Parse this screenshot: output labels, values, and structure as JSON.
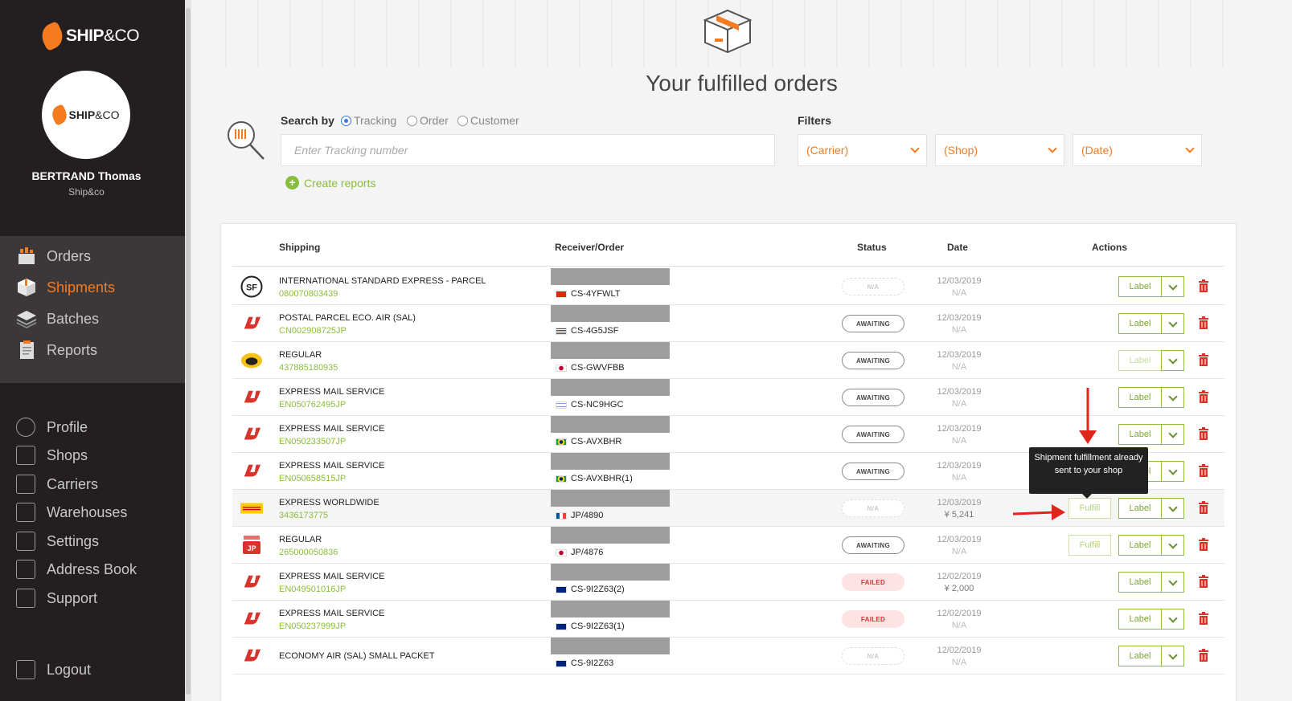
{
  "sidebar": {
    "brand": "SHIP&CO",
    "user_name": "BERTRAND Thomas",
    "user_company": "Ship&co",
    "main_nav": [
      {
        "label": "Orders",
        "icon": "orders-icon",
        "active": false
      },
      {
        "label": "Shipments",
        "icon": "shipments-icon",
        "active": true
      },
      {
        "label": "Batches",
        "icon": "batches-icon",
        "active": false
      },
      {
        "label": "Reports",
        "icon": "reports-icon",
        "active": false
      }
    ],
    "secondary_nav": [
      {
        "label": "Profile",
        "icon": "profile-icon"
      },
      {
        "label": "Shops",
        "icon": "shops-icon"
      },
      {
        "label": "Carriers",
        "icon": "carriers-icon"
      },
      {
        "label": "Warehouses",
        "icon": "warehouses-icon"
      },
      {
        "label": "Settings",
        "icon": "settings-icon"
      },
      {
        "label": "Address Book",
        "icon": "address-book-icon"
      },
      {
        "label": "Support",
        "icon": "support-icon"
      }
    ],
    "logout_label": "Logout"
  },
  "page": {
    "title": "Your fulfilled orders"
  },
  "search": {
    "label": "Search by",
    "options": [
      "Tracking",
      "Order",
      "Customer"
    ],
    "selected": "Tracking",
    "placeholder": "Enter Tracking number",
    "create_reports": "Create reports"
  },
  "filters": {
    "label": "Filters",
    "carrier": "(Carrier)",
    "shop": "(Shop)",
    "date": "(Date)"
  },
  "table": {
    "headers": {
      "shipping": "Shipping",
      "receiver": "Receiver/Order",
      "status": "Status",
      "date": "Date",
      "actions": "Actions"
    },
    "label_button": "Label",
    "fulfill_button": "Fulfill",
    "rows": [
      {
        "carrier": "SF",
        "service": "INTERNATIONAL STANDARD EXPRESS - PARCEL",
        "tracking": "080070803439",
        "flag": "CN",
        "order": "CS-4YFWLT",
        "status": "N/A",
        "status_type": "na",
        "date": "12/03/2019",
        "amount": "N/A",
        "fulfill": false,
        "label_dim": false
      },
      {
        "carrier": "JP",
        "service": "POSTAL PARCEL ECO. AIR (SAL)",
        "tracking": "CN002908725JP",
        "flag": "US",
        "order": "CS-4G5JSF",
        "status": "AWAITING",
        "status_type": "awaiting",
        "date": "12/03/2019",
        "amount": "N/A",
        "fulfill": false,
        "label_dim": false
      },
      {
        "carrier": "YAMATO",
        "service": "REGULAR",
        "tracking": "437885180935",
        "flag": "JP",
        "order": "CS-GWVFBB",
        "status": "AWAITING",
        "status_type": "awaiting",
        "date": "12/03/2019",
        "amount": "N/A",
        "fulfill": false,
        "label_dim": true
      },
      {
        "carrier": "JP",
        "service": "EXPRESS MAIL SERVICE",
        "tracking": "EN050762495JP",
        "flag": "IL",
        "order": "CS-NC9HGC",
        "status": "AWAITING",
        "status_type": "awaiting",
        "date": "12/03/2019",
        "amount": "N/A",
        "fulfill": false,
        "label_dim": false
      },
      {
        "carrier": "JP",
        "service": "EXPRESS MAIL SERVICE",
        "tracking": "EN050233507JP",
        "flag": "BR",
        "order": "CS-AVXBHR",
        "status": "AWAITING",
        "status_type": "awaiting",
        "date": "12/03/2019",
        "amount": "N/A",
        "fulfill": false,
        "label_dim": false
      },
      {
        "carrier": "JP",
        "service": "EXPRESS MAIL SERVICE",
        "tracking": "EN050658515JP",
        "flag": "BR",
        "order": "CS-AVXBHR(1)",
        "status": "AWAITING",
        "status_type": "awaiting",
        "date": "12/03/2019",
        "amount": "N/A",
        "fulfill": false,
        "label_dim": false
      },
      {
        "carrier": "DHL",
        "service": "EXPRESS WORLDWIDE",
        "tracking": "3436173775",
        "flag": "FR",
        "order": "JP/4890",
        "status": "N/A",
        "status_type": "na",
        "date": "12/03/2019",
        "amount": "¥ 5,241",
        "fulfill": true,
        "label_dim": false
      },
      {
        "carrier": "YU",
        "service": "REGULAR",
        "tracking": "265000050836",
        "flag": "JP",
        "order": "JP/4876",
        "status": "AWAITING",
        "status_type": "awaiting",
        "date": "12/03/2019",
        "amount": "N/A",
        "fulfill": true,
        "label_dim": false
      },
      {
        "carrier": "JP",
        "service": "EXPRESS MAIL SERVICE",
        "tracking": "EN049501016JP",
        "flag": "NZ",
        "order": "CS-9I2Z63(2)",
        "status": "FAILED",
        "status_type": "failed",
        "date": "12/02/2019",
        "amount": "¥ 2,000",
        "fulfill": false,
        "label_dim": false
      },
      {
        "carrier": "JP",
        "service": "EXPRESS MAIL SERVICE",
        "tracking": "EN050237999JP",
        "flag": "NZ",
        "order": "CS-9I2Z63(1)",
        "status": "FAILED",
        "status_type": "failed",
        "date": "12/02/2019",
        "amount": "N/A",
        "fulfill": false,
        "label_dim": false
      },
      {
        "carrier": "JP",
        "service": "ECONOMY AIR (SAL) SMALL PACKET",
        "tracking": "",
        "flag": "NZ",
        "order": "CS-9I2Z63",
        "status": "N/A",
        "status_type": "na",
        "date": "12/02/2019",
        "amount": "N/A",
        "fulfill": false,
        "label_dim": false
      }
    ]
  },
  "tooltip": {
    "text": "Shipment fulfillment already sent to your shop"
  },
  "colors": {
    "accent": "#f47b20",
    "green": "#8bbd3c",
    "danger": "#d9342b",
    "sidebar_bg": "#231f20"
  }
}
